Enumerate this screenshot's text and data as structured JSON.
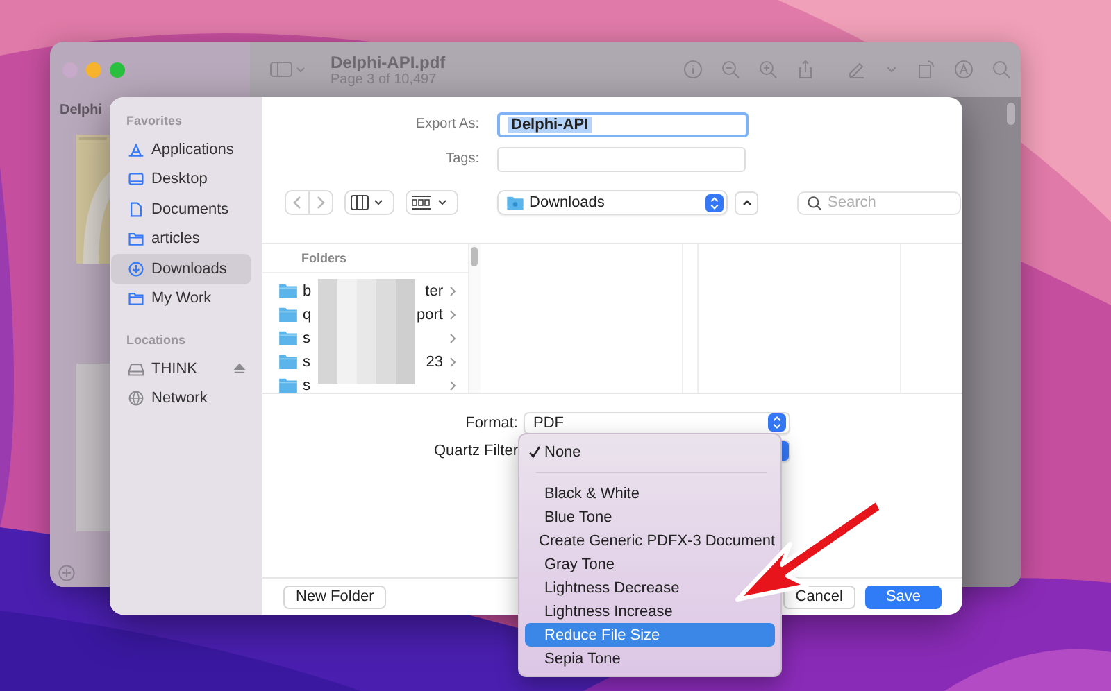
{
  "preview_window": {
    "title": "Delphi-API.pdf",
    "subtitle": "Page 3 of 10,497",
    "sidebar_title": "Delphi"
  },
  "dialog": {
    "export_as": {
      "label": "Export As:",
      "value": "Delphi-API"
    },
    "tags": {
      "label": "Tags:"
    },
    "sidebar": [
      {
        "title": "Favorites",
        "items": [
          {
            "label": "Applications",
            "kind": "applications",
            "selected": false
          },
          {
            "label": "Desktop",
            "kind": "desktop",
            "selected": false
          },
          {
            "label": "Documents",
            "kind": "document",
            "selected": false
          },
          {
            "label": "articles",
            "kind": "folder",
            "selected": false
          },
          {
            "label": "Downloads",
            "kind": "download",
            "selected": true
          },
          {
            "label": "My Work",
            "kind": "folder",
            "selected": false
          }
        ]
      },
      {
        "title": "Locations",
        "items": [
          {
            "label": "THINK",
            "kind": "drive",
            "selected": false,
            "ejectable": true
          },
          {
            "label": "Network",
            "kind": "network",
            "selected": false
          }
        ]
      }
    ],
    "location": "Downloads",
    "search": {
      "placeholder": "Search"
    },
    "browser": {
      "column_title": "Folders",
      "folders": [
        {
          "start": "b",
          "end": "ter"
        },
        {
          "start": "q",
          "end": "port"
        },
        {
          "start": "s"
        },
        {
          "start": "s",
          "end": "23"
        },
        {
          "start": "s"
        }
      ]
    },
    "format": {
      "label": "Format:",
      "value": "PDF"
    },
    "quartz_filter": {
      "label": "Quartz Filter"
    },
    "menu": {
      "items": [
        {
          "label": "None",
          "checked": true,
          "selected": false,
          "separator_after": true
        },
        {
          "label": "Black & White",
          "checked": false,
          "selected": false
        },
        {
          "label": "Blue Tone",
          "checked": false,
          "selected": false
        },
        {
          "label": "Create Generic PDFX-3 Document",
          "checked": false,
          "selected": false
        },
        {
          "label": "Gray Tone",
          "checked": false,
          "selected": false
        },
        {
          "label": "Lightness Decrease",
          "checked": false,
          "selected": false
        },
        {
          "label": "Lightness Increase",
          "checked": false,
          "selected": false
        },
        {
          "label": "Reduce File Size",
          "checked": false,
          "selected": true
        },
        {
          "label": "Sepia Tone",
          "checked": false,
          "selected": false
        }
      ]
    },
    "new_folder_button": "New Folder",
    "buttons": [
      {
        "label": "Cancel",
        "kind": "default"
      },
      {
        "label": "Save",
        "kind": "primary"
      }
    ]
  }
}
